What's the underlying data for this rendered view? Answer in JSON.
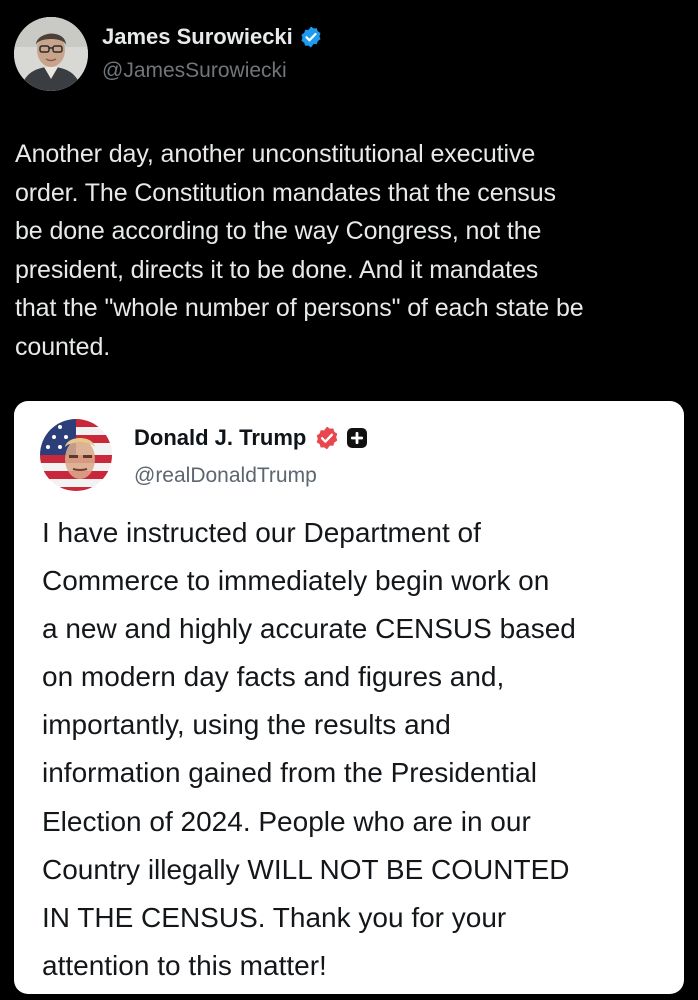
{
  "tweet": {
    "author_name": "James Surowiecki",
    "author_handle": "@JamesSurowiecki",
    "verified_color": "#1d9bf0",
    "text_lines": [
      "Another day, another unconstitutional executive",
      "order. The Constitution mandates that the census",
      "be done according to the way Congress, not the",
      "president, directs it to be done. And it mandates",
      "that the \"whole number of persons\" of each state be",
      "counted."
    ]
  },
  "quoted_post": {
    "author_name": "Donald J. Trump",
    "author_handle": "@realDonaldTrump",
    "badge_color": "#e8474f",
    "text_lines": [
      "I have instructed our Department of",
      "Commerce to immediately begin work on",
      "a new and highly accurate CENSUS based",
      "on modern day facts and figures and,",
      "importantly, using the results and",
      "information gained from the Presidential",
      "Election of 2024. People who are in our",
      "Country illegally WILL NOT BE COUNTED",
      "IN THE CENSUS. Thank you for your",
      "attention to this matter!"
    ]
  }
}
